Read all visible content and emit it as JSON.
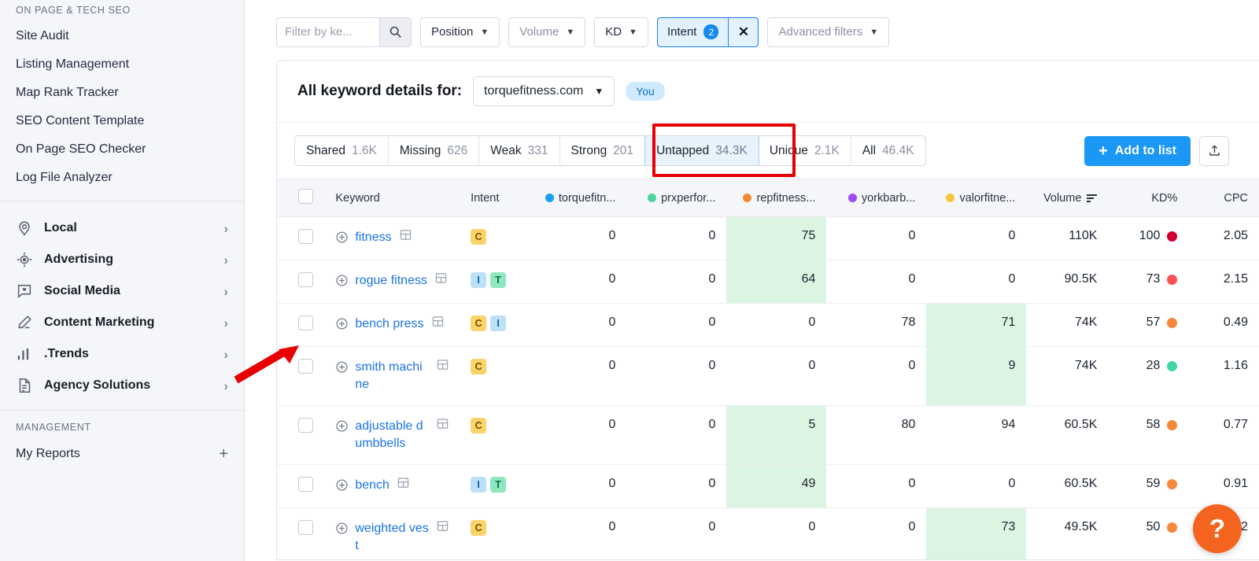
{
  "sidebar": {
    "section_label": "ON PAGE & TECH SEO",
    "links": [
      {
        "label": "Site Audit"
      },
      {
        "label": "Listing Management"
      },
      {
        "label": "Map Rank Tracker"
      },
      {
        "label": "SEO Content Template"
      },
      {
        "label": "On Page SEO Checker"
      },
      {
        "label": "Log File Analyzer"
      }
    ],
    "categories": [
      {
        "label": "Local",
        "icon": "location-pin-icon",
        "chevron": "›"
      },
      {
        "label": "Advertising",
        "icon": "target-icon",
        "chevron": "›"
      },
      {
        "label": "Social Media",
        "icon": "chat-heart-icon",
        "chevron": "›"
      },
      {
        "label": "Content Marketing",
        "icon": "pencil-icon",
        "chevron": "›"
      },
      {
        "label": ".Trends",
        "icon": "bar-chart-icon",
        "chevron": "›"
      },
      {
        "label": "Agency Solutions",
        "icon": "document-icon",
        "chevron": "›"
      }
    ],
    "management_label": "MANAGEMENT",
    "management_items": [
      {
        "label": "My Reports",
        "action": "+"
      }
    ]
  },
  "filters": {
    "search_placeholder": "Filter by ke...",
    "search_value": "",
    "position": "Position",
    "volume": "Volume",
    "kd": "KD",
    "intent": "Intent",
    "intent_count": "2",
    "intent_clear": "✕",
    "advanced": "Advanced filters"
  },
  "panel": {
    "title": "All keyword details for:",
    "domain": "torquefitness.com",
    "you_chip": "You"
  },
  "tabs": [
    {
      "label": "Shared",
      "count": "1.6K",
      "active": false
    },
    {
      "label": "Missing",
      "count": "626",
      "active": false
    },
    {
      "label": "Weak",
      "count": "331",
      "active": false
    },
    {
      "label": "Strong",
      "count": "201",
      "active": false
    },
    {
      "label": "Untapped",
      "count": "34.3K",
      "active": true
    },
    {
      "label": "Unique",
      "count": "2.1K",
      "active": false
    },
    {
      "label": "All",
      "count": "46.4K",
      "active": false
    }
  ],
  "actions": {
    "add_to_list": "Add to list",
    "add_icon": "+",
    "export_icon": "export-icon",
    "help_icon": "?"
  },
  "table": {
    "columns": [
      {
        "key": "checkbox",
        "label": ""
      },
      {
        "key": "keyword",
        "label": "Keyword"
      },
      {
        "key": "intent",
        "label": "Intent"
      },
      {
        "key": "d1",
        "label": "torquefitn...",
        "color": "#1c9ff0"
      },
      {
        "key": "d2",
        "label": "prxperfor...",
        "color": "#4dd4a0"
      },
      {
        "key": "d3",
        "label": "repfitness...",
        "color": "#f58634"
      },
      {
        "key": "d4",
        "label": "yorkbarb...",
        "color": "#9c4df5"
      },
      {
        "key": "d5",
        "label": "valorfitne...",
        "color": "#fbc23c"
      },
      {
        "key": "volume",
        "label": "Volume",
        "sorted": true
      },
      {
        "key": "kd",
        "label": "KD%"
      },
      {
        "key": "cpc",
        "label": "CPC"
      }
    ],
    "rows": [
      {
        "keyword": "fitness",
        "intents": [
          "C"
        ],
        "d1": "0",
        "d2": "0",
        "d3": "75",
        "d4": "0",
        "d5": "0",
        "green": "d3",
        "volume": "110K",
        "kd": "100",
        "kd_color": "#cf0030",
        "cpc": "2.05"
      },
      {
        "keyword": "rogue fitness",
        "intents": [
          "I",
          "T"
        ],
        "d1": "0",
        "d2": "0",
        "d3": "64",
        "d4": "0",
        "d5": "0",
        "green": "d3",
        "volume": "90.5K",
        "kd": "73",
        "kd_color": "#fc5055",
        "cpc": "2.15"
      },
      {
        "keyword": "bench press",
        "intents": [
          "C",
          "I"
        ],
        "d1": "0",
        "d2": "0",
        "d3": "0",
        "d4": "78",
        "d5": "71",
        "green": "d5",
        "volume": "74K",
        "kd": "57",
        "kd_color": "#f5883a",
        "cpc": "0.49"
      },
      {
        "keyword": "smith machine",
        "intents": [
          "C"
        ],
        "d1": "0",
        "d2": "0",
        "d3": "0",
        "d4": "0",
        "d5": "9",
        "green": "d5",
        "volume": "74K",
        "kd": "28",
        "kd_color": "#3fd6a0",
        "cpc": "1.16"
      },
      {
        "keyword": "adjustable dumbbells",
        "intents": [
          "C"
        ],
        "d1": "0",
        "d2": "0",
        "d3": "5",
        "d4": "80",
        "d5": "94",
        "green": "d3",
        "volume": "60.5K",
        "kd": "58",
        "kd_color": "#f5883a",
        "cpc": "0.77"
      },
      {
        "keyword": "bench",
        "intents": [
          "I",
          "T"
        ],
        "d1": "0",
        "d2": "0",
        "d3": "49",
        "d4": "0",
        "d5": "0",
        "green": "d3",
        "volume": "60.5K",
        "kd": "59",
        "kd_color": "#f5883a",
        "cpc": "0.91"
      },
      {
        "keyword": "weighted vest",
        "intents": [
          "C"
        ],
        "d1": "0",
        "d2": "0",
        "d3": "0",
        "d4": "0",
        "d5": "73",
        "green": "d5",
        "volume": "49.5K",
        "kd": "50",
        "kd_color": "#f5883a",
        "cpc": "0.82"
      }
    ]
  }
}
